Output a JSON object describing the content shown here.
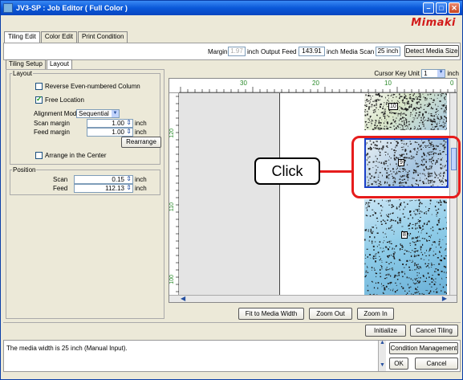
{
  "window": {
    "title": "JV3-SP : Job Editor ( Full Color )",
    "brand": "Mimaki"
  },
  "main_tabs": [
    "Tiling Edit",
    "Color Edit",
    "Print Condition"
  ],
  "header": {
    "margin_label": "Margin",
    "margin_value": "1.97",
    "margin_unit": "inch",
    "output_feed_label": "Output Feed",
    "output_feed_value": "143.91",
    "output_feed_unit": "inch",
    "media_scan_label": "Media Scan",
    "media_scan_value": "25 inch",
    "detect_button": "Detect Media Size"
  },
  "sub_tabs": [
    "Tiling Setup",
    "Layout"
  ],
  "layout_group": {
    "title": "Layout",
    "reverse_label": "Reverse Even-numbered Column",
    "reverse_checked": false,
    "free_location_label": "Free Location",
    "free_location_checked": true,
    "alignment_label": "Alignment Mode",
    "alignment_value": "Sequential",
    "scan_margin_label": "Scan margin",
    "scan_margin_value": "1.00",
    "scan_margin_unit": "inch",
    "feed_margin_label": "Feed margin",
    "feed_margin_value": "1.00",
    "feed_margin_unit": "inch",
    "rearrange_button": "Rearrange",
    "arrange_center_label": "Arrange in the Center",
    "arrange_center_checked": false
  },
  "position_group": {
    "title": "Position",
    "scan_label": "Scan",
    "scan_value": "0.15",
    "scan_unit": "inch",
    "feed_label": "Feed",
    "feed_value": "112.13",
    "feed_unit": "inch"
  },
  "canvas": {
    "cursor_key_label": "Cursor Key Unit",
    "cursor_key_value": "1",
    "cursor_key_unit": "inch",
    "ruler_top": [
      "30",
      "20",
      "10",
      "0"
    ],
    "ruler_left": [
      "120",
      "110",
      "100"
    ],
    "tile_labels": [
      "10",
      "9",
      "8"
    ]
  },
  "zoom": {
    "fit_button": "Fit to Media Width",
    "zoom_out_button": "Zoom Out",
    "zoom_in_button": "Zoom In"
  },
  "bottom": {
    "initialize_button": "Initialize",
    "cancel_tiling_button": "Cancel Tiling"
  },
  "status": {
    "message": "The media width is 25 inch (Manual Input).",
    "condition_button": "Condition Management",
    "ok_button": "OK",
    "cancel_button": "Cancel"
  },
  "callout": {
    "text": "Click"
  },
  "colors": {
    "title_bar": "#0a58d8",
    "brand": "#d21a1a",
    "highlight": "#e61c1c"
  }
}
